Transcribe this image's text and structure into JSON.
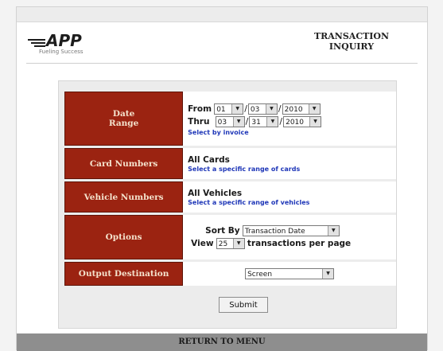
{
  "header": {
    "logo_text": "APP",
    "logo_subtext": "Fueling Success",
    "title_line1": "TRANSACTION",
    "title_line2": "INQUIRY"
  },
  "date_range": {
    "label_line1": "Date",
    "label_line2": "Range",
    "from_label": "From",
    "from_month": "01",
    "from_day": "03",
    "from_year": "2010",
    "thru_label": "Thru",
    "thru_month": "03",
    "thru_day": "31",
    "thru_year": "2010",
    "select_by_invoice_link": "Select by invoice"
  },
  "card_numbers": {
    "label": "Card Numbers",
    "value": "All Cards",
    "link": "Select a specific range of cards"
  },
  "vehicle_numbers": {
    "label": "Vehicle Numbers",
    "value": "All Vehicles",
    "link": "Select a specific range of vehicles"
  },
  "options": {
    "label": "Options",
    "sort_by_label": "Sort By",
    "sort_by_value": "Transaction Date",
    "view_label": "View",
    "view_value": "25",
    "per_page_label": "transactions per page"
  },
  "output_destination": {
    "label": "Output Destination",
    "value": "Screen"
  },
  "submit_label": "Submit",
  "footer_link": "RETURN TO MENU",
  "colors": {
    "label_bg": "#9b2311",
    "label_text": "#f4e2cc",
    "link": "#1f37b8",
    "footer_bg": "#8e8e8e"
  }
}
